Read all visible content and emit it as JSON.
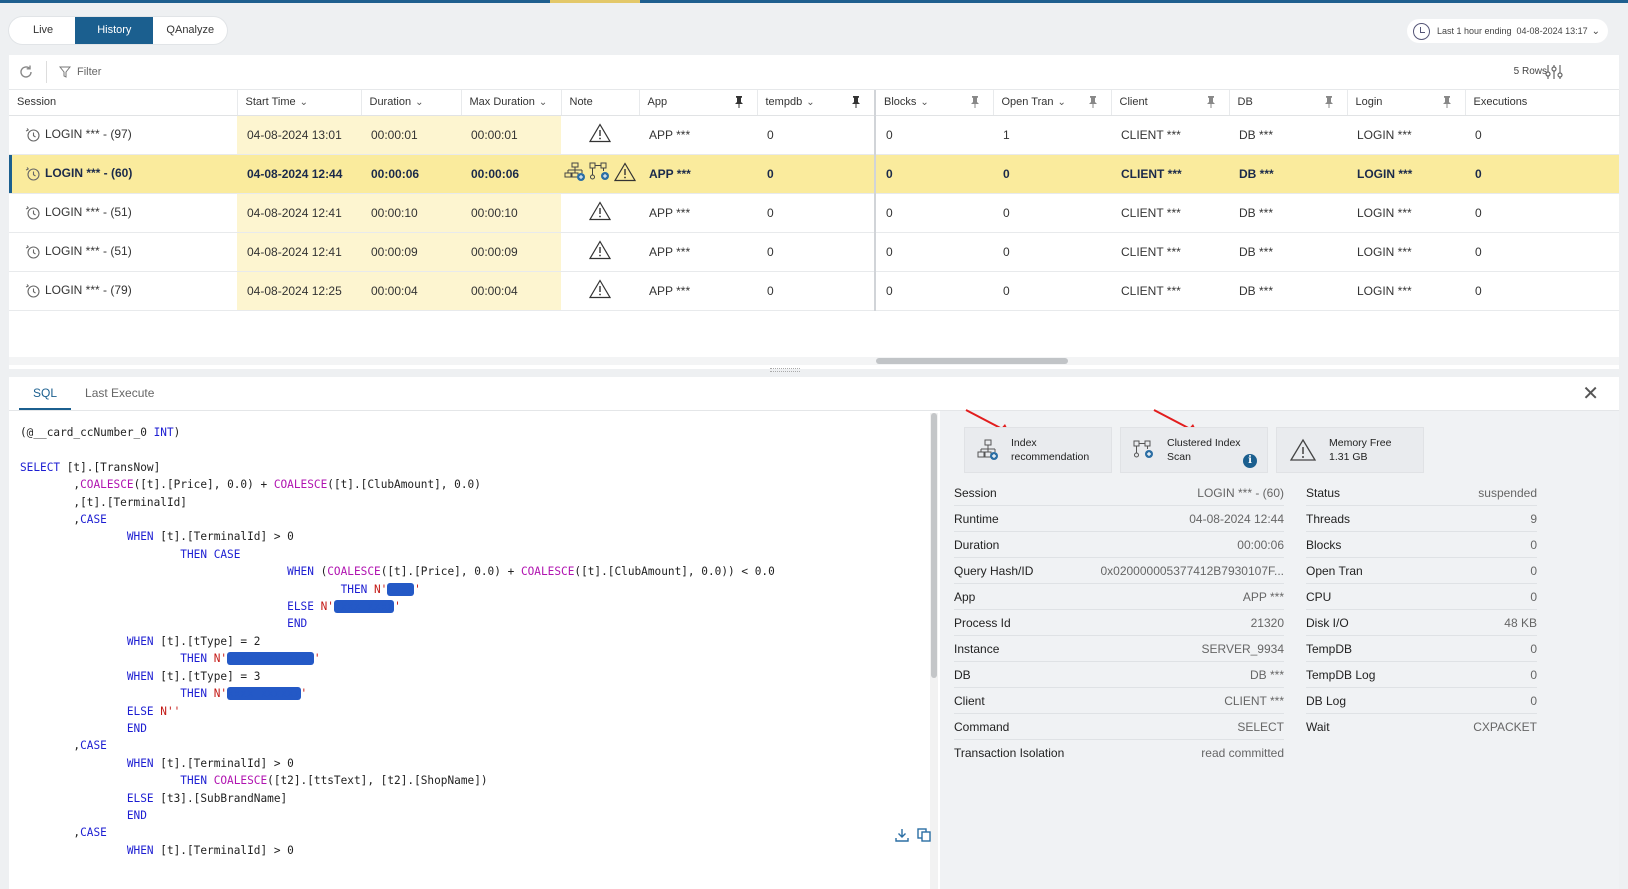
{
  "modes": {
    "live": "Live",
    "history": "History",
    "qanalyze": "QAnalyze"
  },
  "timerange": {
    "label": "Last 1 hour ending",
    "value": "04-08-2024 13:17"
  },
  "toolbar": {
    "filter_label": "Filter",
    "rows_label": "5 Rows"
  },
  "columns": {
    "session": "Session",
    "start_time": "Start Time",
    "duration": "Duration",
    "max_duration": "Max Duration",
    "note": "Note",
    "app": "App",
    "tempdb": "tempdb",
    "blocks": "Blocks",
    "open_tran": "Open Tran",
    "client": "Client",
    "db": "DB",
    "login": "Login",
    "executions": "Executions"
  },
  "rows": [
    {
      "session": "LOGIN *** - (97)",
      "start_time": "04-08-2024 13:01",
      "duration": "00:00:01",
      "max_duration": "00:00:01",
      "app": "APP ***",
      "tempdb": "0",
      "blocks": "0",
      "open_tran": "1",
      "client": "CLIENT ***",
      "db": "DB ***",
      "login": "LOGIN ***",
      "executions": "0"
    },
    {
      "session": "LOGIN *** - (60)",
      "start_time": "04-08-2024 12:44",
      "duration": "00:00:06",
      "max_duration": "00:00:06",
      "app": "APP ***",
      "tempdb": "0",
      "blocks": "0",
      "open_tran": "0",
      "client": "CLIENT ***",
      "db": "DB ***",
      "login": "LOGIN ***",
      "executions": "0"
    },
    {
      "session": "LOGIN *** - (51)",
      "start_time": "04-08-2024 12:41",
      "duration": "00:00:10",
      "max_duration": "00:00:10",
      "app": "APP ***",
      "tempdb": "0",
      "blocks": "0",
      "open_tran": "0",
      "client": "CLIENT ***",
      "db": "DB ***",
      "login": "LOGIN ***",
      "executions": "0"
    },
    {
      "session": "LOGIN *** - (51)",
      "start_time": "04-08-2024 12:41",
      "duration": "00:00:09",
      "max_duration": "00:00:09",
      "app": "APP ***",
      "tempdb": "0",
      "blocks": "0",
      "open_tran": "0",
      "client": "CLIENT ***",
      "db": "DB ***",
      "login": "LOGIN ***",
      "executions": "0"
    },
    {
      "session": "LOGIN *** - (79)",
      "start_time": "04-08-2024 12:25",
      "duration": "00:00:04",
      "max_duration": "00:00:04",
      "app": "APP ***",
      "tempdb": "0",
      "blocks": "0",
      "open_tran": "0",
      "client": "CLIENT ***",
      "db": "DB ***",
      "login": "LOGIN ***",
      "executions": "0"
    }
  ],
  "bottom_tabs": {
    "sql": "SQL",
    "last_execute": "Last Execute"
  },
  "sql_lines": [
    "(@__card_ccNumber_0 INT)",
    "",
    "SELECT [t].[TransNow]",
    "        ,COALESCE([t].[Price], 0.0) + COALESCE([t].[ClubAmount], 0.0)",
    "        ,[t].[TerminalId]",
    "        ,CASE",
    "                WHEN [t].[TerminalId] > 0",
    "                        THEN CASE",
    "                                        WHEN (COALESCE([t].[Price], 0.0) + COALESCE([t].[ClubAmount], 0.0)) < 0.0",
    "                                                THEN N'",
    "                                        ELSE N'",
    "                                        END",
    "                WHEN [t].[tType] = 2",
    "                        THEN N'",
    "                WHEN [t].[tType] = 3",
    "                        THEN N'",
    "                ELSE N''",
    "                END",
    "        ,CASE",
    "                WHEN [t].[TerminalId] > 0",
    "                        THEN COALESCE([t2].[ttsText], [t2].[ShopName])",
    "                ELSE [t3].[SubBrandName]",
    "                END",
    "        ,CASE",
    "                WHEN [t].[TerminalId] > 0"
  ],
  "cards": {
    "index_rec": {
      "line1": "Index",
      "line2": "recommendation"
    },
    "clustered": {
      "line1": "Clustered Index",
      "line2": "Scan"
    },
    "memory": {
      "line1": "Memory Free",
      "line2": "1.31 GB"
    }
  },
  "details_left": [
    {
      "k": "Session",
      "v": "LOGIN *** - (60)"
    },
    {
      "k": "Runtime",
      "v": "04-08-2024 12:44"
    },
    {
      "k": "Duration",
      "v": "00:00:06"
    },
    {
      "k": "Query Hash/ID",
      "v": "0x020000005377412B7930107F..."
    },
    {
      "k": "App",
      "v": "APP ***"
    },
    {
      "k": "Process Id",
      "v": "21320"
    },
    {
      "k": "Instance",
      "v": "SERVER_9934"
    },
    {
      "k": "DB",
      "v": "DB ***"
    },
    {
      "k": "Client",
      "v": "CLIENT ***"
    },
    {
      "k": "Command",
      "v": "SELECT"
    },
    {
      "k": "Transaction Isolation",
      "v": "read committed"
    }
  ],
  "details_right": [
    {
      "k": "Status",
      "v": "suspended"
    },
    {
      "k": "Threads",
      "v": "9"
    },
    {
      "k": "Blocks",
      "v": "0"
    },
    {
      "k": "Open Tran",
      "v": "0"
    },
    {
      "k": "CPU",
      "v": "0"
    },
    {
      "k": "Disk I/O",
      "v": "48 KB"
    },
    {
      "k": "TempDB",
      "v": "0"
    },
    {
      "k": "TempDB Log",
      "v": "0"
    },
    {
      "k": "DB Log",
      "v": "0"
    },
    {
      "k": "Wait",
      "v": "CXPACKET"
    }
  ]
}
